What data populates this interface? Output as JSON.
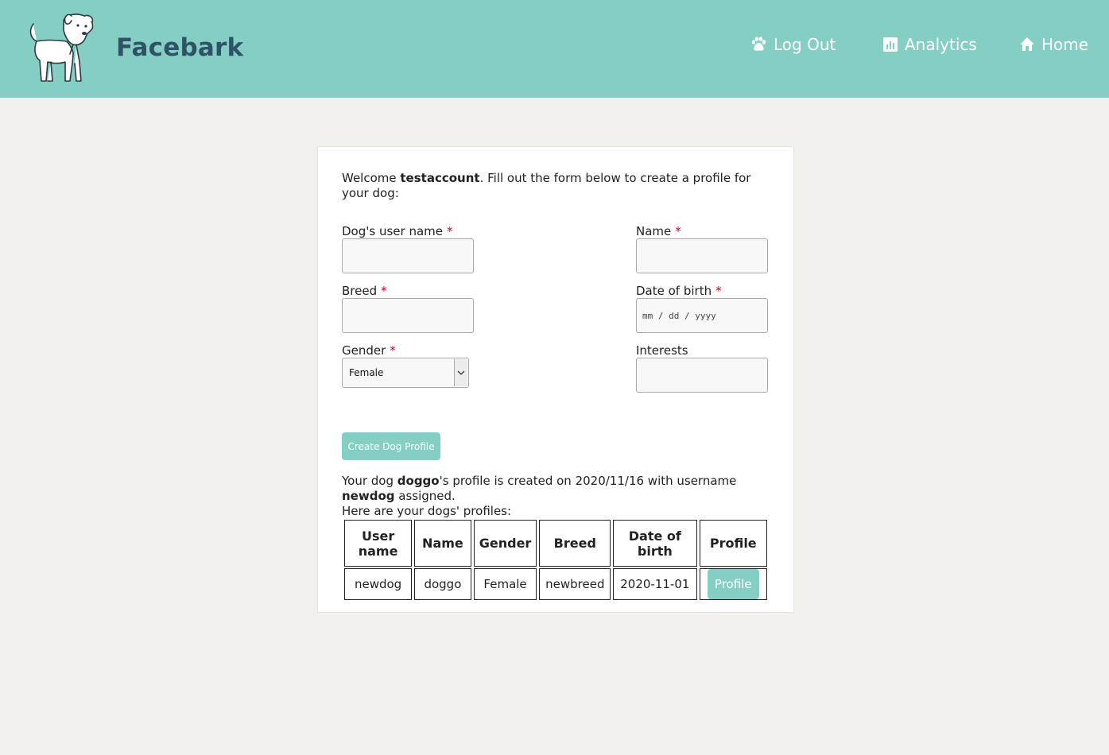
{
  "header": {
    "brand": "Facebark",
    "nav": {
      "logout": "Log Out",
      "analytics": "Analytics",
      "home": "Home"
    }
  },
  "form": {
    "welcome_prefix": "Welcome ",
    "username": "testaccount",
    "welcome_suffix": ". Fill out the form below to create a profile for your dog:",
    "fields": {
      "dog_username": {
        "label": "Dog's user name",
        "value": ""
      },
      "name": {
        "label": "Name",
        "value": ""
      },
      "breed": {
        "label": "Breed",
        "value": ""
      },
      "dob": {
        "label": "Date of birth",
        "placeholder": "mm / dd / yyyy"
      },
      "gender": {
        "label": "Gender",
        "value": "Female"
      },
      "interests": {
        "label": "Interests",
        "value": ""
      }
    },
    "required_mark": "*",
    "submit_label": "Create Dog Profile"
  },
  "result": {
    "part1": "Your dog ",
    "dog_name": "doggo",
    "part2": "'s profile is created on 2020/11/16 with username ",
    "dog_username": "newdog",
    "part3": " assigned.",
    "list_intro": "Here are your dogs' profiles:"
  },
  "table": {
    "headers": [
      "User name",
      "Name",
      "Gender",
      "Breed",
      "Date of birth",
      "Profile"
    ],
    "rows": [
      {
        "username": "newdog",
        "name": "doggo",
        "gender": "Female",
        "breed": "newbreed",
        "dob": "2020-11-01",
        "profile_label": "Profile"
      }
    ]
  },
  "colors": {
    "header_bg": "#84cec4",
    "brand_text": "#2f5366",
    "accent": "#84cec4",
    "required": "#d0021b"
  }
}
